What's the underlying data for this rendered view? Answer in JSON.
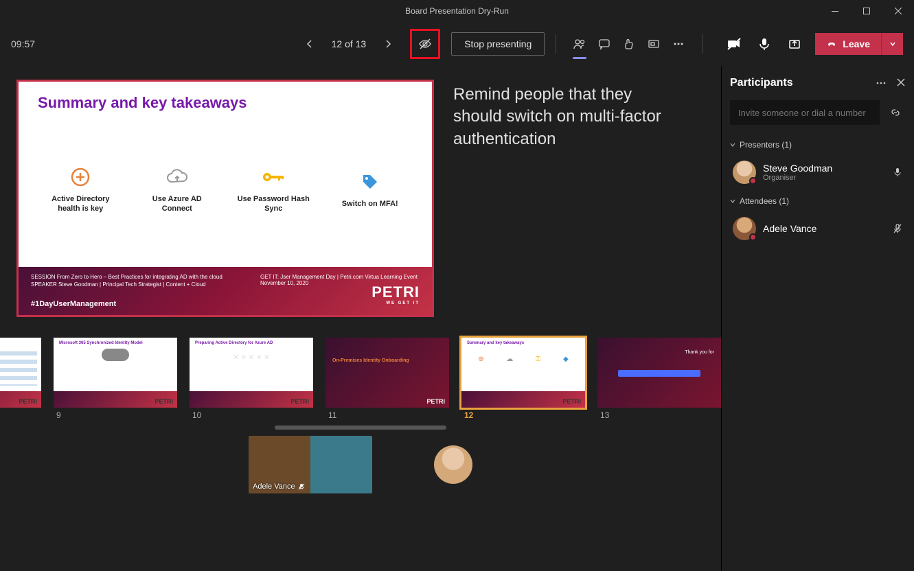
{
  "window": {
    "title": "Board Presentation Dry-Run"
  },
  "toolbar": {
    "timer": "09:57",
    "slide_counter": "12 of 13",
    "stop_label": "Stop presenting",
    "leave_label": "Leave"
  },
  "presenter_note": "Remind people that they should switch on multi-factor authentication",
  "slide": {
    "title": "Summary and key takeaways",
    "takeaways": [
      {
        "icon": "plus-circle",
        "label_a": "Active Directory",
        "label_b": "health is key"
      },
      {
        "icon": "cloud",
        "label_a": "Use Azure AD",
        "label_b": "Connect"
      },
      {
        "icon": "key",
        "label_a": "Use Password Hash",
        "label_b": "Sync"
      },
      {
        "icon": "tag",
        "label_a": "Switch on MFA!",
        "label_b": ""
      }
    ],
    "session": "SESSION  From Zero to Hero – Best Practices for integrating AD with the cloud",
    "speaker": "SPEAKER  Steve Goodman | Principal Tech Strategist | Content + Cloud",
    "event": "GET IT: Jser Management Day | Petri.com Virtua Learning Event",
    "date": "November 10, 2020",
    "hashtag": "#1DayUserManagement",
    "brand": "PETRI",
    "brand_sub": "WE GET IT"
  },
  "thumbs": [
    {
      "num": "",
      "title": ""
    },
    {
      "num": "9",
      "title": "Microsoft 365 Synchronized Identity Model"
    },
    {
      "num": "10",
      "title": "Preparing Active Directory for Azure AD"
    },
    {
      "num": "11",
      "title": "On-Premises Identity Onboarding"
    },
    {
      "num": "12",
      "title": "Summary and key takeaways"
    },
    {
      "num": "13",
      "title": "Thank you for"
    }
  ],
  "panel": {
    "title": "Participants",
    "invite_placeholder": "Invite someone or dial a number",
    "group_presenters": "Presenters (1)",
    "group_attendees": "Attendees (1)",
    "presenters": [
      {
        "name": "Steve Goodman",
        "role": "Organiser"
      }
    ],
    "attendees": [
      {
        "name": "Adele Vance",
        "role": ""
      }
    ]
  },
  "video_row": {
    "name": "Adele Vance"
  }
}
